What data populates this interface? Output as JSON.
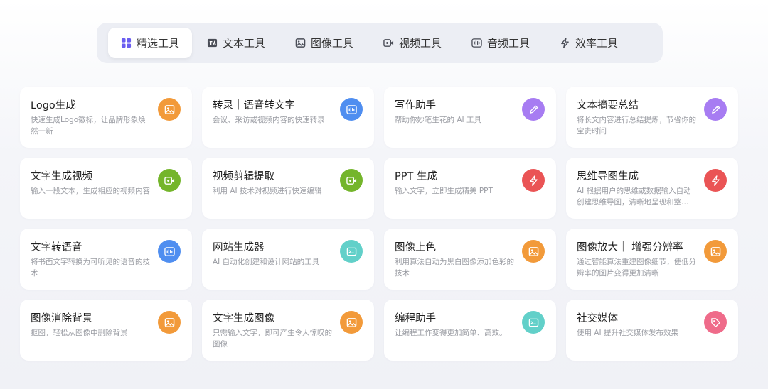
{
  "tabs": [
    {
      "label": "精选工具",
      "icon": "grid-icon",
      "active": true
    },
    {
      "label": "文本工具",
      "icon": "text-icon",
      "active": false
    },
    {
      "label": "图像工具",
      "icon": "image-icon",
      "active": false
    },
    {
      "label": "视频工具",
      "icon": "video-icon",
      "active": false
    },
    {
      "label": "音频工具",
      "icon": "audio-icon",
      "active": false
    },
    {
      "label": "效率工具",
      "icon": "lightning-icon",
      "active": false
    }
  ],
  "colors": {
    "orange": "#f29a3a",
    "blue": "#4f8ef0",
    "purple": "#a77cf2",
    "green": "#74b52b",
    "red": "#ea5455",
    "teal": "#62d0c9",
    "pink": "#ef6b8a",
    "active_tab_icon": "#6a5df0"
  },
  "cards": [
    {
      "title": "Logo生成",
      "desc": "快速生成Logo徽标，让品牌形象焕然一新",
      "icon": "image-icon",
      "color": "orange"
    },
    {
      "title": "转录｜语音转文字",
      "desc": "会议、采访或视频内容的快速转录",
      "icon": "audio-icon",
      "color": "blue"
    },
    {
      "title": "写作助手",
      "desc": "帮助你妙笔生花的 AI 工具",
      "icon": "pencil-icon",
      "color": "purple"
    },
    {
      "title": "文本摘要总结",
      "desc": "将长文内容进行总结提炼，节省你的宝贵时间",
      "icon": "pencil-icon",
      "color": "purple"
    },
    {
      "title": "文字生成视频",
      "desc": "输入一段文本，生成相应的视频内容",
      "icon": "video-icon",
      "color": "green"
    },
    {
      "title": "视频剪辑提取",
      "desc": "利用 AI 技术对视频进行快速编辑",
      "icon": "video-icon",
      "color": "green"
    },
    {
      "title": "PPT 生成",
      "desc": "输入文字，立即生成精美 PPT",
      "icon": "lightning-icon",
      "color": "red"
    },
    {
      "title": "思维导图生成",
      "desc": "AI 根据用户的思维或数据输入自动创建思维导图，清晰地呈现和整…",
      "icon": "lightning-icon",
      "color": "red"
    },
    {
      "title": "文字转语音",
      "desc": "将书面文字转换为可听见的语音的技术",
      "icon": "audio-icon",
      "color": "blue"
    },
    {
      "title": "网站生成器",
      "desc": "AI 自动化创建和设计网站的工具",
      "icon": "terminal-icon",
      "color": "teal"
    },
    {
      "title": "图像上色",
      "desc": "利用算法自动为黑白图像添加色彩的技术",
      "icon": "image-icon",
      "color": "orange"
    },
    {
      "title": "图像放大｜ 增强分辨率",
      "desc": "通过智能算法重建图像细节，使低分辨率的图片变得更加清晰",
      "icon": "image-icon",
      "color": "orange"
    },
    {
      "title": "图像消除背景",
      "desc": "抠图，轻松从图像中删除背景",
      "icon": "image-icon",
      "color": "orange"
    },
    {
      "title": "文字生成图像",
      "desc": "只需输入文字，即可产生令人惊叹的图像",
      "icon": "image-icon",
      "color": "orange"
    },
    {
      "title": "编程助手",
      "desc": "让编程工作变得更加简单、高效。",
      "icon": "terminal-icon",
      "color": "teal"
    },
    {
      "title": "社交媒体",
      "desc": "使用 AI 提升社交媒体发布效果",
      "icon": "tag-icon",
      "color": "pink"
    }
  ]
}
